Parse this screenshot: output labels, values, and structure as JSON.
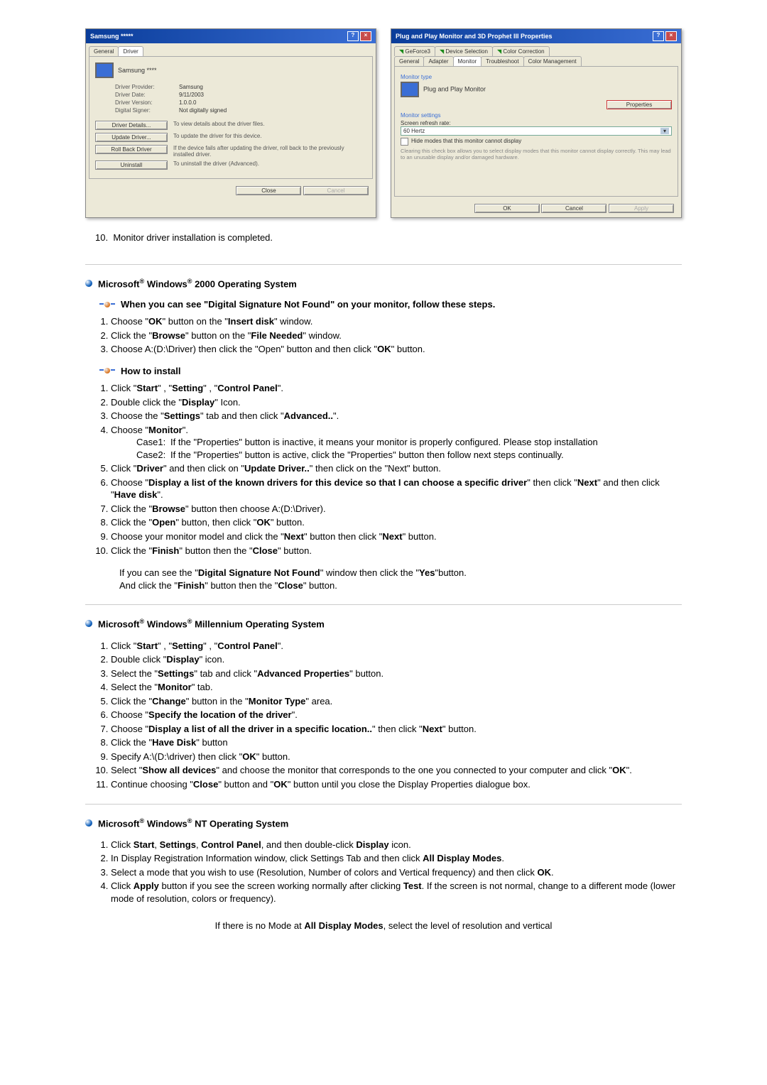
{
  "dialogs": {
    "left": {
      "title": "Samsung *****",
      "tabs": {
        "general": "General",
        "driver": "Driver"
      },
      "device": "Samsung ****",
      "fields": {
        "provider_lbl": "Driver Provider:",
        "provider_val": "Samsung",
        "date_lbl": "Driver Date:",
        "date_val": "9/11/2003",
        "version_lbl": "Driver Version:",
        "version_val": "1.0.0.0",
        "signer_lbl": "Digital Signer:",
        "signer_val": "Not digitally signed"
      },
      "rows": {
        "details_btn": "Driver Details...",
        "details_desc": "To view details about the driver files.",
        "update_btn": "Update Driver...",
        "update_desc": "To update the driver for this device.",
        "rollback_btn": "Roll Back Driver",
        "rollback_desc": "If the device fails after updating the driver, roll back to the previously installed driver.",
        "uninstall_btn": "Uninstall",
        "uninstall_desc": "To uninstall the driver (Advanced)."
      },
      "close": "Close",
      "cancel": "Cancel"
    },
    "right": {
      "title": "Plug and Play Monitor and 3D Prophet III Properties",
      "tabs_top": {
        "gf": "GeForce3",
        "dev": "Device Selection",
        "cc": "Color Correction"
      },
      "tabs_bot": {
        "gen": "General",
        "adp": "Adapter",
        "mon": "Monitor",
        "trb": "Troubleshoot",
        "cm": "Color Management"
      },
      "montype_lbl": "Monitor type",
      "montype_val": "Plug and Play Monitor",
      "props_btn": "Properties",
      "settings_lbl": "Monitor settings",
      "refresh_lbl": "Screen refresh rate:",
      "refresh_val": "60 Hertz",
      "hide_check": "Hide modes that this monitor cannot display",
      "warn": "Clearing this check box allows you to select display modes that this monitor cannot display correctly. This may lead to an unusable display and/or damaged hardware.",
      "ok": "OK",
      "cancel": "Cancel",
      "apply": "Apply"
    }
  },
  "completion": {
    "num": "10.",
    "text": "Monitor driver installation is completed."
  },
  "os2000": {
    "heading_pre": "Microsoft",
    "heading_mid": " Windows",
    "heading_post": " 2000 Operating System",
    "sub1": "When you can see \"Digital Signature Not Found\" on your monitor, follow these steps.",
    "steps1": [
      {
        "pre": "Choose \"",
        "b1": "OK",
        "mid": "\" button on the \"",
        "b2": "Insert disk",
        "post": "\" window."
      },
      {
        "pre": "Click the \"",
        "b1": "Browse",
        "mid": "\" button on the \"",
        "b2": "File Needed",
        "post": "\" window."
      },
      {
        "plain": "Choose A:(D:\\Driver) then click the \"Open\" button and then click \"",
        "b1": "OK",
        "post": "\" button."
      }
    ],
    "sub2": "How to install",
    "steps2": {
      "s1": {
        "pre": "Click \"",
        "b1": "Start",
        "m1": "\" , \"",
        "b2": "Setting",
        "m2": "\" , \"",
        "b3": "Control Panel",
        "post": "\"."
      },
      "s2": {
        "pre": "Double click the \"",
        "b1": "Display",
        "post": "\" Icon."
      },
      "s3": {
        "pre": "Choose the \"",
        "b1": "Settings",
        "mid": "\" tab and then click \"",
        "b2": "Advanced..",
        "post": "\"."
      },
      "s4": {
        "pre": "Choose \"",
        "b1": "Monitor",
        "post": "\"."
      },
      "case1_lbl": "Case1:",
      "case1_txt": "If the \"Properties\" button is inactive, it means your monitor is properly configured. Please stop installation",
      "case2_lbl": "Case2:",
      "case2_txt": "If the \"Properties\" button is active, click the \"Properties\" button then follow next steps continually.",
      "s5": {
        "pre": "Click \"",
        "b1": "Driver",
        "mid": "\" and then click on \"",
        "b2": "Update Driver..",
        "post": "\" then click on the \"Next\" button."
      },
      "s6": {
        "pre": "Choose \"",
        "b1": "Display a list of the known drivers for this device so that I can choose a specific driver",
        "mid": "\" then click \"",
        "b2": "Next",
        "m2": "\" and then click \"",
        "b3": "Have disk",
        "post": "\"."
      },
      "s7": {
        "pre": "Click the \"",
        "b1": "Browse",
        "post": "\" button then choose A:(D:\\Driver)."
      },
      "s8": {
        "pre": "Click the \"",
        "b1": "Open",
        "mid": "\" button, then click \"",
        "b2": "OK",
        "post": "\" button."
      },
      "s9": {
        "pre": "Choose your monitor model and click the \"",
        "b1": "Next",
        "mid": "\" button then click \"",
        "b2": "Next",
        "post": "\" button."
      },
      "s10": {
        "pre": "Click the \"",
        "b1": "Finish",
        "mid": "\" button then the \"",
        "b2": "Close",
        "post": "\" button."
      }
    },
    "post1": {
      "pre": "If you can see the \"",
      "b1": "Digital Signature Not Found",
      "mid": "\" window then click the \"",
      "b2": "Yes",
      "post": "\"button."
    },
    "post2": {
      "pre": "And click the \"",
      "b1": "Finish",
      "mid": "\" button then the \"",
      "b2": "Close",
      "post": "\" button."
    }
  },
  "osme": {
    "heading_pre": "Microsoft",
    "heading_mid": " Windows",
    "heading_post": " Millennium Operating System",
    "steps": {
      "s1": {
        "pre": "Click \"",
        "b1": "Start",
        "m1": "\" , \"",
        "b2": "Setting",
        "m2": "\" , \"",
        "b3": "Control Panel",
        "post": "\"."
      },
      "s2": {
        "pre": "Double click \"",
        "b1": "Display",
        "post": "\" icon."
      },
      "s3": {
        "pre": "Select the \"",
        "b1": "Settings",
        "mid": "\" tab and click \"",
        "b2": "Advanced Properties",
        "post": "\" button."
      },
      "s4": {
        "pre": "Select the \"",
        "b1": "Monitor",
        "post": "\" tab."
      },
      "s5": {
        "pre": "Click the \"",
        "b1": "Change",
        "mid": "\" button in the \"",
        "b2": "Monitor Type",
        "post": "\" area."
      },
      "s6": {
        "pre": "Choose \"",
        "b1": "Specify the location of the driver",
        "post": "\"."
      },
      "s7": {
        "pre": "Choose \"",
        "b1": "Display a list of all the driver in a specific location..",
        "mid": "\" then click \"",
        "b2": "Next",
        "post": "\" button."
      },
      "s8": {
        "pre": "Click the \"",
        "b1": "Have Disk",
        "post": "\" button"
      },
      "s9": {
        "pre": "Specify A:\\(D:\\driver) then click \"",
        "b1": "OK",
        "post": "\" button."
      },
      "s10": {
        "pre": "Select \"",
        "b1": "Show all devices",
        "mid": "\" and choose the monitor that corresponds to the one you connected to your computer and click \"",
        "b2": "OK",
        "post": "\"."
      },
      "s11": {
        "pre": "Continue choosing \"",
        "b1": "Close",
        "mid": "\" button and \"",
        "b2": "OK",
        "post": "\" button until you close the Display Properties dialogue box."
      }
    }
  },
  "osnt": {
    "heading_pre": "Microsoft",
    "heading_mid": " Windows",
    "heading_post": " NT Operating System",
    "steps": {
      "s1": {
        "pre": "Click ",
        "b1": "Start",
        "m1": ", ",
        "b2": "Settings",
        "m2": ", ",
        "b3": "Control Panel",
        "m3": ", and then double-click ",
        "b4": "Display",
        "post": " icon."
      },
      "s2": {
        "pre": "In Display Registration Information window, click Settings Tab and then click ",
        "b1": "All Display Modes",
        "post": "."
      },
      "s3": {
        "pre": "Select a mode that you wish to use (Resolution, Number of colors and Vertical frequency) and then click ",
        "b1": "OK",
        "post": "."
      },
      "s4": {
        "pre": "Click ",
        "b1": "Apply",
        "mid": " button if you see the screen working normally after clicking ",
        "b2": "Test",
        "post": ". If the screen is not normal, change to a different mode (lower mode of resolution, colors or frequency)."
      }
    },
    "note": {
      "pre": "If there is no Mode at ",
      "b1": "All Display Modes",
      "post": ", select the level of resolution and vertical"
    }
  }
}
